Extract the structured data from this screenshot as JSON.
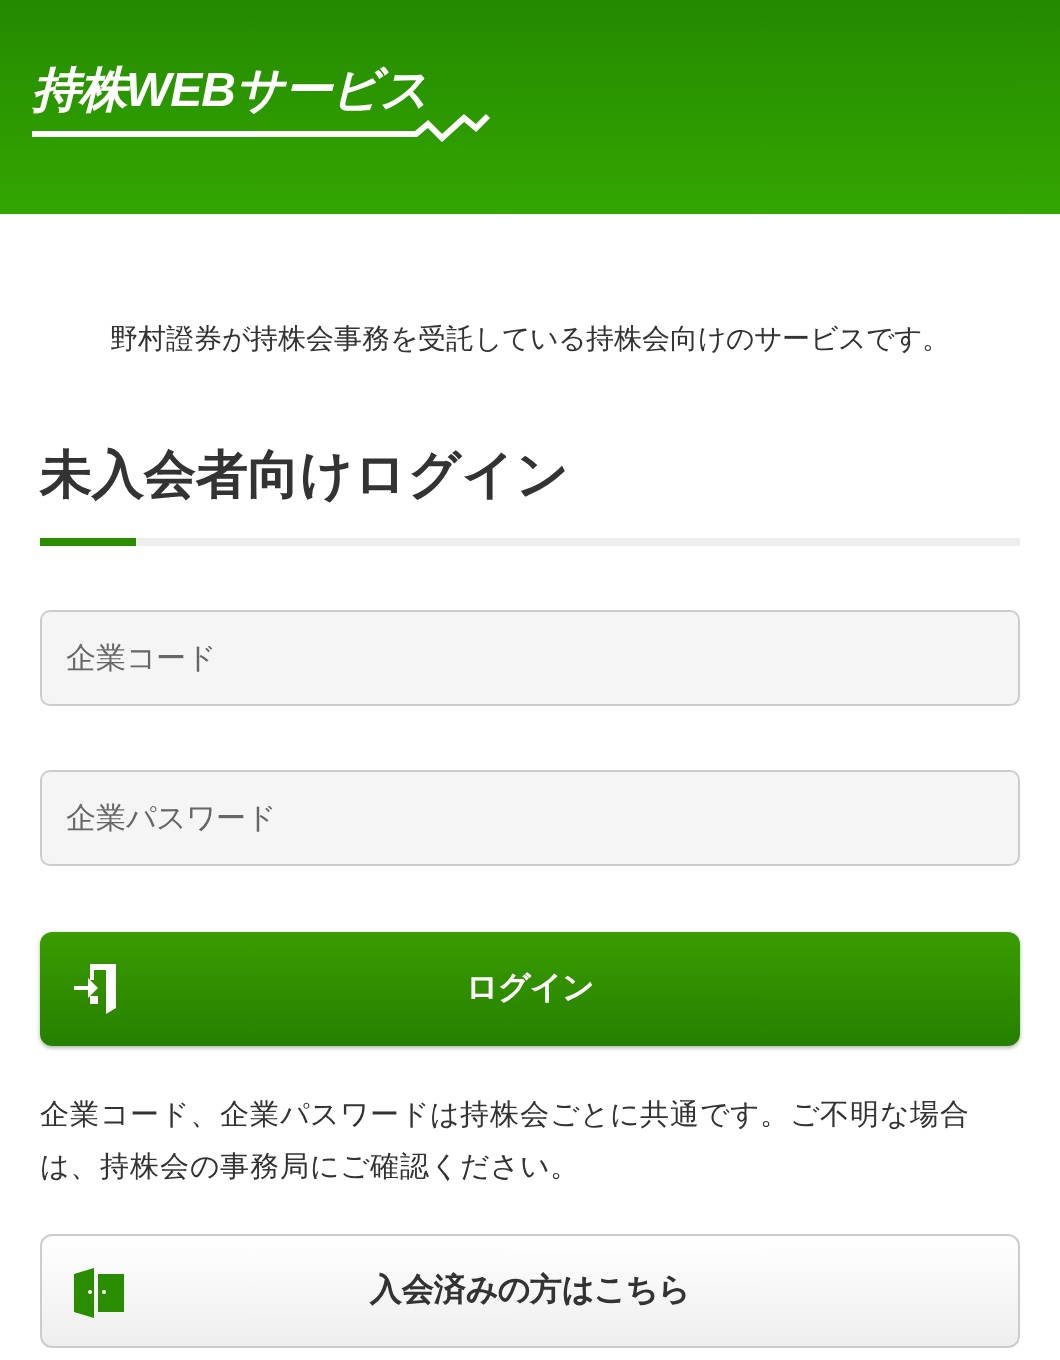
{
  "header": {
    "logo": "持株WEBサービス"
  },
  "intro": "野村證券が持株会事務を受託している持株会向けのサービスです。",
  "heading": "未入会者向けログイン",
  "fields": [
    {
      "placeholder": "企業コード"
    },
    {
      "placeholder": "企業パスワード"
    }
  ],
  "login_button": "ログイン",
  "note": "企業コード、企業パスワードは持株会ごとに共通です。ご不明な場合は、持株会の事務局にご確認ください。",
  "member_button": "入会済みの方はこちら"
}
